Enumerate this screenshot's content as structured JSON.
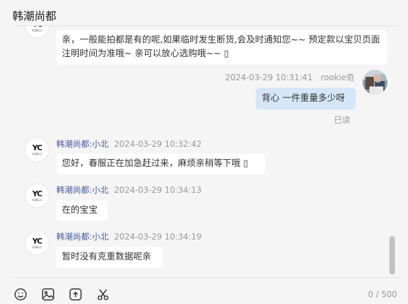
{
  "header": {
    "title": "韩潮尚都"
  },
  "messages": [
    {
      "side": "left",
      "text": "亲，一般能拍都是有的呢,如果临时发生断货,会及时通知您~~  预定款以宝贝页面注明时间为准哦~  亲可以放心选购哦~~ ▯"
    },
    {
      "side": "right",
      "sender": "rookie奇",
      "time": "2024-03-29 10:31:41",
      "text": "背心 一件重量多少呀",
      "status": "已读"
    },
    {
      "side": "left",
      "sender": "韩潮尚都:小北",
      "time": "2024-03-29 10:32:42",
      "text": "您好，春服正在加急赶过来，麻烦亲稍等下哦 ▯"
    },
    {
      "side": "left",
      "sender": "韩潮尚都:小北",
      "time": "2024-03-29 10:34:13",
      "text": "在的宝宝"
    },
    {
      "side": "left",
      "sender": "韩潮尚都:小北",
      "time": "2024-03-29 10:34:19",
      "text": "暂时没有克重数据呢亲"
    }
  ],
  "shop_avatar": {
    "monogram": "YC",
    "subtext": "YUNG·C"
  },
  "toolbar": {
    "icons": [
      "emoji-icon",
      "image-icon",
      "upload-icon",
      "scissors-icon"
    ],
    "counter": "0 / 500"
  },
  "colors": {
    "bubble_right": "#d6e6f8",
    "sender_name": "#4a5a9e",
    "background": "#f5f5f5"
  }
}
